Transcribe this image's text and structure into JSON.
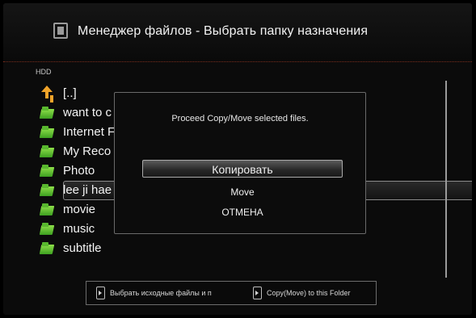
{
  "header": {
    "title": "Менеджер файлов - Выбрать папку назначения",
    "icon": "file-manager-icon"
  },
  "drive": {
    "label": "HDD"
  },
  "files": [
    {
      "label": "[..]",
      "icon": "up-folder-icon"
    },
    {
      "label": "want to c",
      "icon": "folder-icon"
    },
    {
      "label": "Internet F",
      "icon": "folder-icon"
    },
    {
      "label": "My Reco",
      "icon": "folder-icon"
    },
    {
      "label": "Photo",
      "icon": "folder-icon"
    },
    {
      "label": "lee ji hae",
      "icon": "folder-icon",
      "selected": true
    },
    {
      "label": "movie",
      "icon": "folder-icon"
    },
    {
      "label": "music",
      "icon": "folder-icon"
    },
    {
      "label": "subtitle",
      "icon": "folder-icon"
    }
  ],
  "dialog": {
    "message": "Proceed Copy/Move selected files.",
    "copy_label": "Копировать",
    "move_label": "Move",
    "cancel_label": "ОТМЕНА"
  },
  "hints": {
    "select_source": "Выбрать исходные файлы и п",
    "copy_move": "Copy(Move) to this Folder"
  },
  "colors": {
    "folder": "#5cc232",
    "up_arrow": "#f0a42a",
    "divider": "#7a2d1c"
  }
}
